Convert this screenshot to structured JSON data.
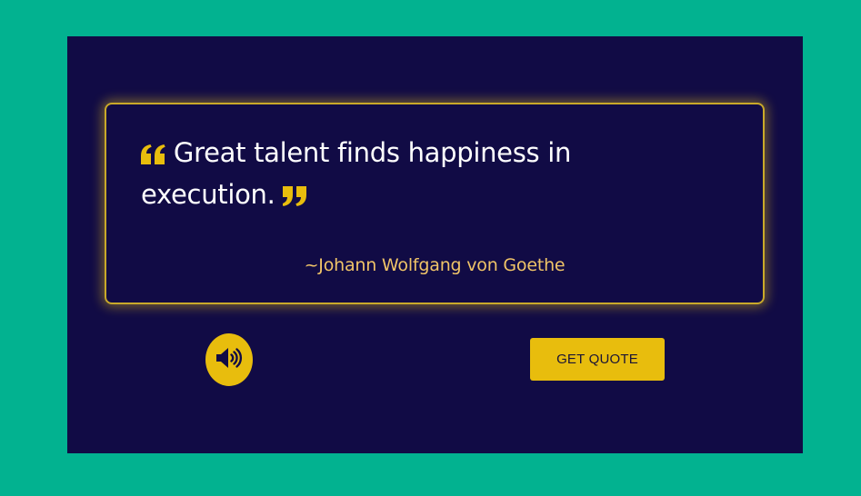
{
  "quote": {
    "text": "Great talent finds happiness in execution.",
    "author": "~Johann Wolfgang von Goethe"
  },
  "controls": {
    "speak_icon": "volume-up-icon",
    "get_quote_label": "GET QUOTE"
  },
  "colors": {
    "page_background": "#02b290",
    "panel_background": "#110b45",
    "accent": "#e8bd0d",
    "author_text": "#f0c468",
    "quote_text": "#ffffff"
  }
}
